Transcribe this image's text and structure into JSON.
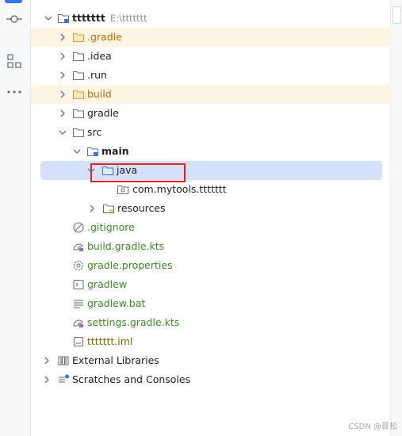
{
  "project": {
    "name": "ttttttt",
    "path": "E:\\ttttttt"
  },
  "tree": {
    "items": [
      {
        "label": ".gradle"
      },
      {
        "label": ".idea"
      },
      {
        "label": ".run"
      },
      {
        "label": "build"
      },
      {
        "label": "gradle"
      },
      {
        "label": "src"
      },
      {
        "label": "main"
      },
      {
        "label": "java"
      },
      {
        "label": "com.mytools.ttttttt"
      },
      {
        "label": "resources"
      },
      {
        "label": ".gitignore"
      },
      {
        "label": "build.gradle.kts"
      },
      {
        "label": "gradle.properties"
      },
      {
        "label": "gradlew"
      },
      {
        "label": "gradlew.bat"
      },
      {
        "label": "settings.gradle.kts"
      },
      {
        "label": "ttttttt.iml"
      }
    ],
    "external_libraries": "External Libraries",
    "scratches": "Scratches and Consoles"
  },
  "watermark": "CSDN @晋松",
  "colors": {
    "accent": "#3574f0",
    "excluded_bg": "#fdf5e3",
    "selected_bg": "#d5e1fa",
    "highlight": "#e2222a"
  }
}
